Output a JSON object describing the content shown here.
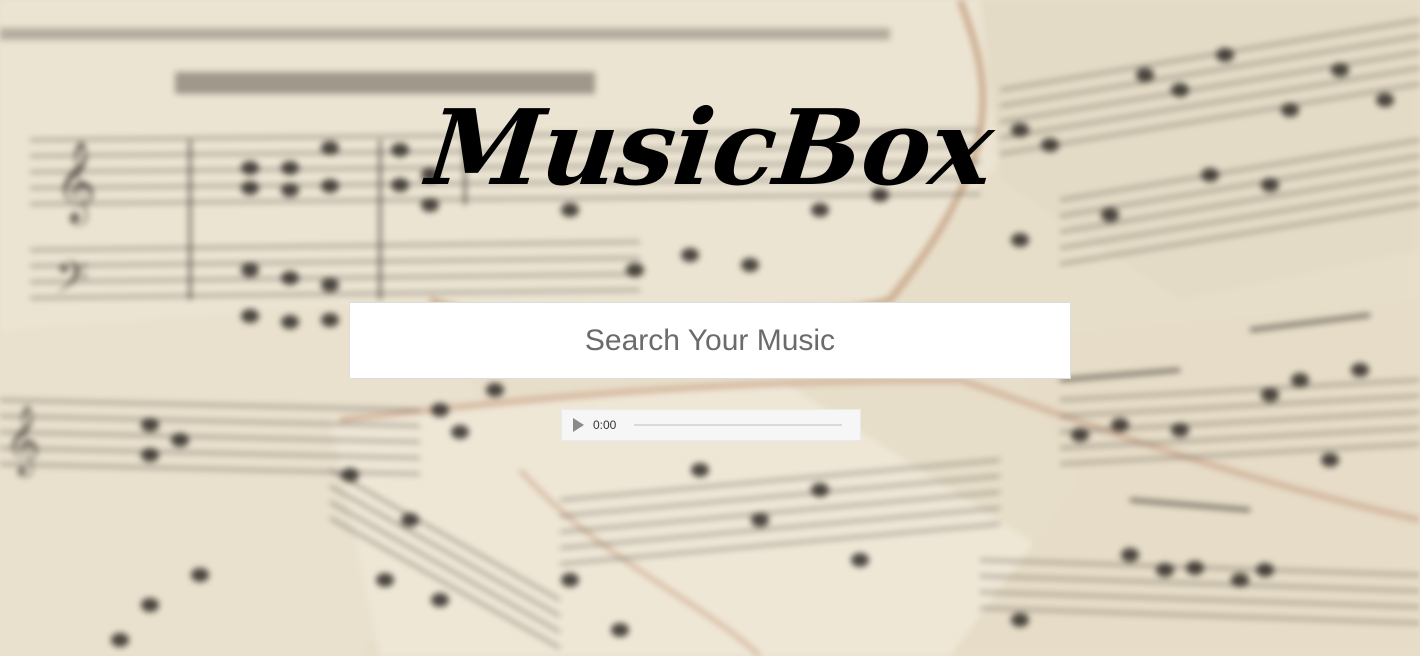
{
  "app": {
    "logo_text": "MusicBox"
  },
  "search": {
    "placeholder": "Search Your Music",
    "value": ""
  },
  "player": {
    "current_time": "0:00",
    "progress": 0
  },
  "colors": {
    "background": "#e8dfcd",
    "logo": "#000000",
    "search_bg": "#ffffff",
    "player_bg": "#f6f6f6"
  },
  "icons": {
    "play": "play-icon"
  }
}
